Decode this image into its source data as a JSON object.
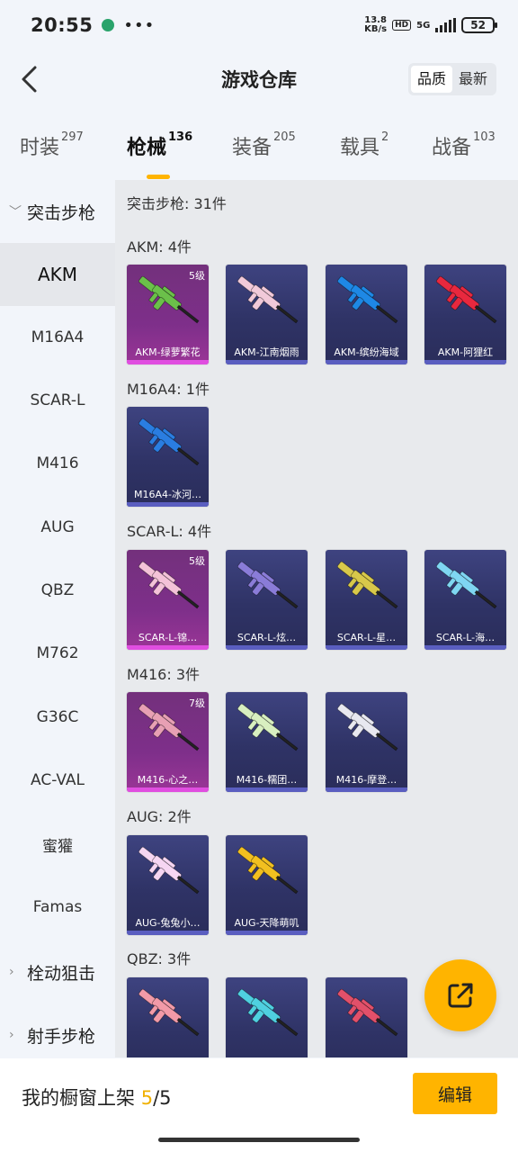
{
  "status_bar": {
    "time": "20:55",
    "net_speed_value": "13.8",
    "net_speed_unit": "KB/s",
    "hd": "HD",
    "network": "5G",
    "battery": "52"
  },
  "header": {
    "title": "游戏仓库",
    "sort_options": [
      "品质",
      "最新"
    ]
  },
  "tabs": [
    {
      "label": "时装",
      "count": "297"
    },
    {
      "label": "枪械",
      "count": "136"
    },
    {
      "label": "装备",
      "count": "205"
    },
    {
      "label": "载具",
      "count": "2"
    },
    {
      "label": "战备",
      "count": "103"
    }
  ],
  "sidebar": {
    "expanded_category": "突击步枪",
    "subitems": [
      "AKM",
      "M16A4",
      "SCAR-L",
      "M416",
      "AUG",
      "QBZ",
      "M762",
      "G36C",
      "AC-VAL",
      "蜜獾",
      "Famas"
    ],
    "collapsed_categories": [
      "栓动狙击",
      "射手步枪"
    ]
  },
  "content": {
    "summary": "突击步枪: 31件",
    "sections": [
      {
        "title": "AKM: 4件",
        "items": [
          {
            "name": "AKM-绿萝繁花",
            "level": "5级",
            "rarity": "legendary",
            "color": "#6bc04a"
          },
          {
            "name": "AKM-江南烟雨",
            "level": "",
            "rarity": "epic",
            "color": "#f1c9d9"
          },
          {
            "name": "AKM-缤纷海域",
            "level": "",
            "rarity": "epic",
            "color": "#1e88e5"
          },
          {
            "name": "AKM-阿狸红",
            "level": "",
            "rarity": "epic",
            "color": "#e8283e"
          }
        ]
      },
      {
        "title": "M16A4: 1件",
        "items": [
          {
            "name": "M16A4-冰河…",
            "level": "",
            "rarity": "epic",
            "color": "#2a7de1"
          }
        ]
      },
      {
        "title": "SCAR-L: 4件",
        "items": [
          {
            "name": "SCAR-L-锦…",
            "level": "5级",
            "rarity": "legendary",
            "color": "#f4c2d8"
          },
          {
            "name": "SCAR-L-炫…",
            "level": "",
            "rarity": "epic",
            "color": "#8a7cd8"
          },
          {
            "name": "SCAR-L-星…",
            "level": "",
            "rarity": "epic",
            "color": "#d8c84a"
          },
          {
            "name": "SCAR-L-海…",
            "level": "",
            "rarity": "epic",
            "color": "#7fd6f2"
          }
        ]
      },
      {
        "title": "M416: 3件",
        "items": [
          {
            "name": "M416-心之…",
            "level": "7级",
            "rarity": "legendary",
            "color": "#e8a0b4"
          },
          {
            "name": "M416-糯团…",
            "level": "",
            "rarity": "epic",
            "color": "#d8efc0"
          },
          {
            "name": "M416-摩登…",
            "level": "",
            "rarity": "epic",
            "color": "#e8e8f0"
          }
        ]
      },
      {
        "title": "AUG: 2件",
        "items": [
          {
            "name": "AUG-兔兔小…",
            "level": "",
            "rarity": "epic",
            "color": "#f6d6f2"
          },
          {
            "name": "AUG-天降萌叽",
            "level": "",
            "rarity": "epic",
            "color": "#f2c020"
          }
        ]
      },
      {
        "title": "QBZ: 3件",
        "items": [
          {
            "name": "",
            "level": "",
            "rarity": "epic",
            "color": "#f29aa8"
          },
          {
            "name": "",
            "level": "",
            "rarity": "epic",
            "color": "#4fd0e0"
          },
          {
            "name": "",
            "level": "",
            "rarity": "epic",
            "color": "#e2506a"
          }
        ]
      }
    ]
  },
  "fab": {
    "icon": "share-external-icon"
  },
  "bottom_bar": {
    "label": "我的橱窗上架",
    "current": "5",
    "separator": "/",
    "total": "5",
    "edit_label": "编辑"
  }
}
